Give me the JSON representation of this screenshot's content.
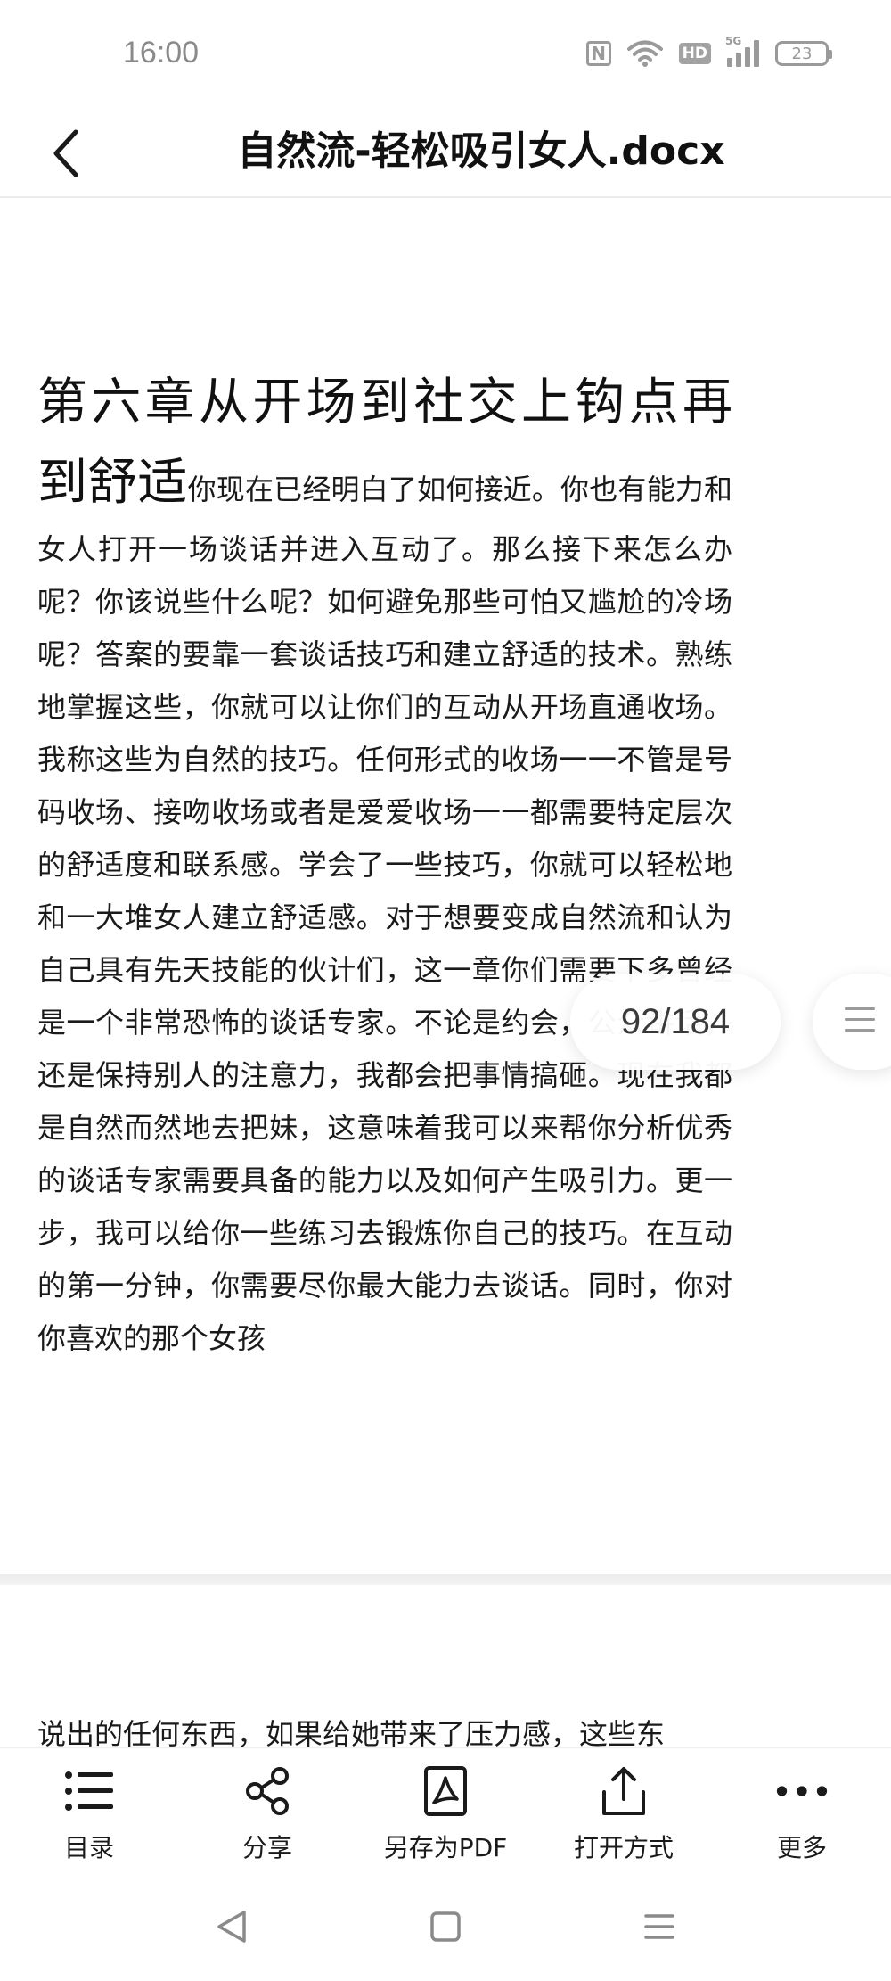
{
  "status_bar": {
    "time": "16:00",
    "nfc_label": "N",
    "hd_label": "HD",
    "network_label": "5G",
    "battery_level": "23"
  },
  "header": {
    "title": "自然流-轻松吸引女人.docx"
  },
  "document": {
    "page_1": {
      "chapter_heading": "第六章从开场到社交上钩点再到舒适",
      "body": "你现在已经明白了如何接近。你也有能力和女人打开一场谈话并进入互动了。那么接下来怎么办呢？你该说些什么呢？如何避免那些可怕又尴尬的冷场呢？答案的要靠一套谈话技巧和建立舒适的技术。熟练地掌握这些，你就可以让你们的互动从开场直通收场。我称这些为自然的技巧。任何形式的收场一一不管是号码收场、接吻收场或者是爱爱收场一一都需要特定层次的舒适度和联系感。学会了一些技巧，你就可以轻松地和一大堆女人建立舒适感。对于想要变成自然流和认为自己具有先天技能的伙计们，这一章你们需要下多曾经是一个非常恐怖的谈话专家。不论是约会，公众讲话，还是保持别人的注意力，我都会把事情搞砸。现在我都是自然而然地去把妹，这意味着我可以来帮你分析优秀的谈话专家需要具备的能力以及如何产生吸引力。更一步，我可以给你一些练习去锻炼你自己的技巧。在互动的第一分钟，你需要尽你最大能力去谈话。同时，你对你喜欢的那个女孩"
    },
    "page_2": {
      "body": "说出的任何东西，如果给她带来了压力感，这些东"
    }
  },
  "page_indicator": {
    "text": "92/184"
  },
  "toolbar": {
    "items": [
      {
        "label": "目录",
        "icon": "list-icon"
      },
      {
        "label": "分享",
        "icon": "share-icon"
      },
      {
        "label": "另存为PDF",
        "icon": "pdf-icon"
      },
      {
        "label": "打开方式",
        "icon": "upload-icon"
      },
      {
        "label": "更多",
        "icon": "more-icon"
      }
    ]
  },
  "navigation": {
    "buttons": [
      "back-triangle-icon",
      "home-square-icon",
      "menu-lines-icon"
    ]
  }
}
